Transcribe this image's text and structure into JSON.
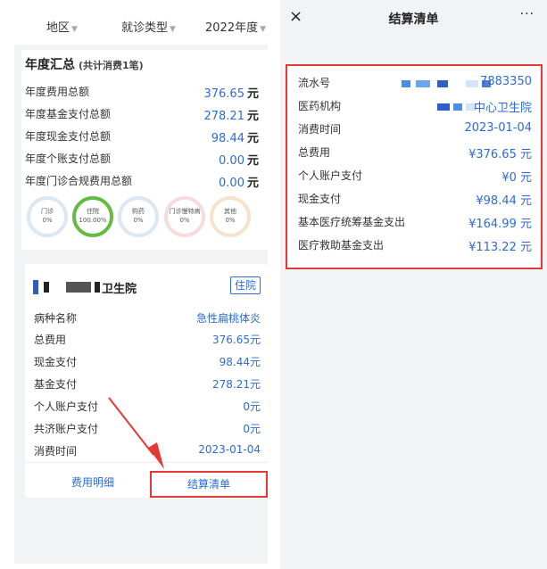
{
  "left": {
    "filters": [
      {
        "label": "地区",
        "caret": "▼"
      },
      {
        "label": "就诊类型",
        "caret": "▼"
      },
      {
        "label": "2022年度",
        "caret": "▼"
      }
    ],
    "summary": {
      "title": "年度汇总",
      "subtitle": "(共计消费1笔)",
      "rows": [
        {
          "label": "年度费用总额",
          "value": "376.65",
          "unit": "元"
        },
        {
          "label": "年度基金支付总额",
          "value": "278.21",
          "unit": "元"
        },
        {
          "label": "年度现金支付总额",
          "value": "98.44",
          "unit": "元"
        },
        {
          "label": "年度个账支付总额",
          "value": "0.00",
          "unit": "元"
        },
        {
          "label": "年度门诊合规费用总额",
          "value": "0.00",
          "unit": "元"
        }
      ],
      "circles": [
        {
          "label": "门诊",
          "pct": "0%"
        },
        {
          "label": "住院",
          "pct": "100.00%"
        },
        {
          "label": "购药",
          "pct": "0%"
        },
        {
          "label": "门诊慢特病",
          "pct": "0%"
        },
        {
          "label": "其他",
          "pct": "0%"
        }
      ]
    },
    "detail": {
      "hospital_name": "卫生院",
      "tag": "住院",
      "rows": [
        {
          "label": "病种名称",
          "value": "急性扁桃体炎"
        },
        {
          "label": "总费用",
          "value": "376.65元"
        },
        {
          "label": "现金支付",
          "value": "98.44元"
        },
        {
          "label": "基金支付",
          "value": "278.21元"
        },
        {
          "label": "个人账户支付",
          "value": "0元"
        },
        {
          "label": "共济账户支付",
          "value": "0元"
        },
        {
          "label": "消费时间",
          "value": "2023-01-04"
        }
      ],
      "fee_detail_label": "费用明细",
      "bill_label": "结算清单"
    }
  },
  "right": {
    "nav": {
      "close": "×",
      "title": "结算清单",
      "more": "···"
    },
    "rows": [
      {
        "label": "流水号",
        "value": "7883350"
      },
      {
        "label": "医药机构",
        "value": "中心卫生院"
      },
      {
        "label": "消费时间",
        "value": "2023-01-04"
      },
      {
        "label": "总费用",
        "value": "¥376.65 元"
      },
      {
        "label": "个人账户支付",
        "value": "¥0 元"
      },
      {
        "label": "现金支付",
        "value": "¥98.44 元"
      },
      {
        "label": "基本医疗统筹基金支出",
        "value": "¥164.99 元"
      },
      {
        "label": "医疗救助基金支出",
        "value": "¥113.22 元"
      }
    ]
  },
  "colors": {
    "accent": "#2d6bd6",
    "highlight": "#e53935",
    "inpatient_ring": "#66bb44"
  }
}
